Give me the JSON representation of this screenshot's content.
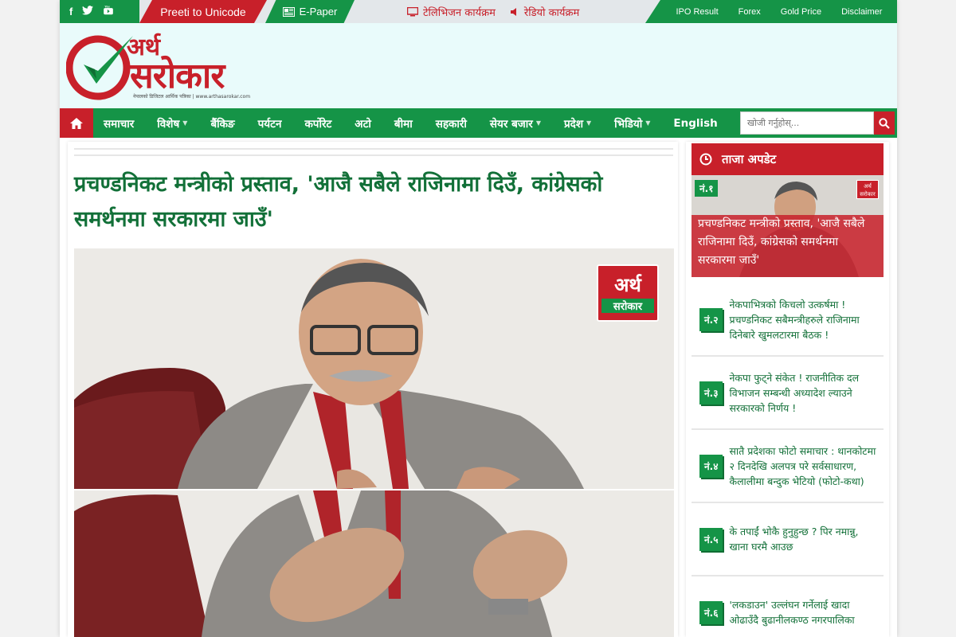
{
  "topbar": {
    "social": [
      "f",
      "t",
      "yt"
    ],
    "preeti": "Preeti to Unicode",
    "epaper": "E-Paper",
    "tv": "टेलिभिजन कार्यक्रम",
    "radio": "रेडियो कार्यक्रम",
    "right_links": [
      "IPO Result",
      "Forex",
      "Gold Price",
      "Disclaimer"
    ]
  },
  "logo": {
    "line1": "अर्थ",
    "line2": "सरोकार",
    "tagline": "नेपालको डिजिटल आर्थिक पत्रिका | www.arthasarokar.com"
  },
  "nav": {
    "items": [
      {
        "label": "समाचार",
        "caret": false
      },
      {
        "label": "विशेष",
        "caret": true
      },
      {
        "label": "बैंकिङ",
        "caret": false
      },
      {
        "label": "पर्यटन",
        "caret": false
      },
      {
        "label": "कर्पोरेट",
        "caret": false
      },
      {
        "label": "अटो",
        "caret": false
      },
      {
        "label": "बीमा",
        "caret": false
      },
      {
        "label": "सहकारी",
        "caret": false
      },
      {
        "label": "सेयर बजार",
        "caret": true
      },
      {
        "label": "प्रदेश",
        "caret": true
      },
      {
        "label": "भिडियो",
        "caret": true
      },
      {
        "label": "English",
        "caret": false
      }
    ],
    "search_placeholder": "खोजी गर्नुहोस्..."
  },
  "article": {
    "headline": "प्रचण्डनिकट मन्त्रीको प्रस्ताव, 'आजै सबैले राजिनामा दिउँ, कांग्रेसको समर्थनमा सरकारमा जाउँ'",
    "image_logo_line1": "अर्थ",
    "image_logo_line2": "सरोकार"
  },
  "sidebar": {
    "heading": "ताजा अपडेट",
    "heading_icon": "clock-icon",
    "feature": {
      "no": "नं.१",
      "title": "प्रचण्डनिकट मन्त्रीको प्रस्ताव, 'आजै सबैले राजिनामा दिउँ, कांग्रेसको समर्थनमा सरकारमा जाउँ'"
    },
    "items": [
      {
        "no": "नं.२",
        "title": "नेकपाभित्रको किचलो उत्कर्षमा ! प्रचण्डनिकट सबैमन्त्रीहरुले राजिनामा दिनेबारे खुमलटारमा बैठक !"
      },
      {
        "no": "नं.३",
        "title": "नेकपा फुट्ने संकेत ! राजनीतिक दल विभाजन सम्बन्धी अध्यादेश ल्याउने सरकारको निर्णय !"
      },
      {
        "no": "नं.४",
        "title": "सातै प्रदेशका फोटो समाचार : थानकोटमा २ दिनदेखि अलपत्र परे सर्वसाधारण, कैलालीमा बन्दुक भेटियो (फोटो-कथा)"
      },
      {
        "no": "नं.५",
        "title": "के तपाईं भोकै हुनुहुन्छ ? पिर नमान्नु, खाना घरमै आउछ"
      },
      {
        "no": "नं.६",
        "title": "'लकडाउन' उल्लंघन गर्नेलाई खादा ओढाउँदै बुढानीलकण्ठ नगरपालिका"
      }
    ]
  },
  "colors": {
    "green": "#159447",
    "red": "#c8202a",
    "headline_green": "#127038"
  }
}
